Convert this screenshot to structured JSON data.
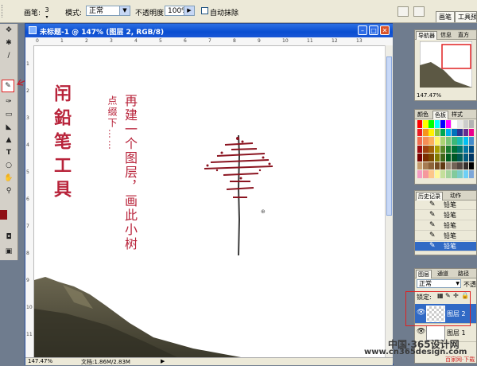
{
  "options_bar": {
    "brush_label": "画笔:",
    "brush_size": "3",
    "mode_label": "模式:",
    "mode_value": "正常",
    "opacity_label": "不透明度:",
    "opacity_value": "100%",
    "auto_erase_label": "自动抹除",
    "tab_brushes": "画笔",
    "tab_tool_presets": "工具预"
  },
  "document": {
    "title": "未标题-1 @ 147% (图层 2, RGB/8)",
    "zoom_status": "147.47%",
    "doc_status": "文档:1.86M/2.83M",
    "ruler_top": [
      "0",
      "1",
      "2",
      "3",
      "4",
      "5",
      "6",
      "7",
      "8",
      "9",
      "10",
      "11",
      "12",
      "13"
    ],
    "ruler_left": [
      "1",
      "2",
      "3",
      "4",
      "5",
      "6",
      "7",
      "8",
      "9",
      "10",
      "11"
    ]
  },
  "annotations": {
    "tool_note": "闬鉛笔工具",
    "instruction": "再建一个图层，画此小树",
    "note2": "点缀下……"
  },
  "navigator": {
    "tabs": [
      "导航器",
      "信息",
      "直方"
    ],
    "zoom": "147.47%"
  },
  "colors_panel": {
    "tabs": [
      "颜色",
      "色板",
      "样式"
    ]
  },
  "history": {
    "tabs": [
      "历史记录",
      "动作"
    ],
    "items": [
      "铅笔",
      "铅笔",
      "铅笔",
      "铅笔",
      "铅笔"
    ]
  },
  "layers": {
    "tabs": [
      "图层",
      "通道",
      "路径"
    ],
    "blend_mode": "正常",
    "opacity_label": "不透",
    "lock_label": "锁定:",
    "items": [
      "图层 2",
      "图层 1"
    ]
  },
  "watermark": {
    "line1": "中国·365设计网",
    "line2": "www.cn365design.com",
    "line3": "百家网·下载"
  },
  "accent_colors": {
    "annotation_red": "#b8233a",
    "tree_red": "#8b1420",
    "highlight_box": "#e02020",
    "titlebar_blue": "#0a4ed1",
    "foreground_color": "#8f0f16"
  }
}
